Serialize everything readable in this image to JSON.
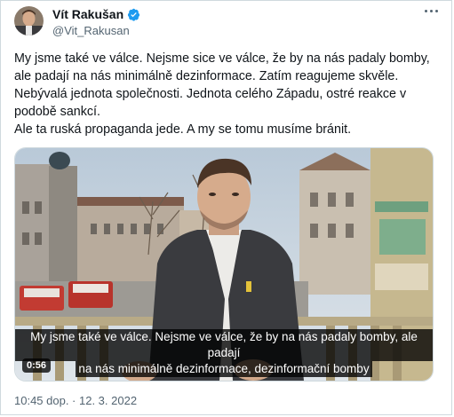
{
  "author": {
    "name": "Vít Rakušan",
    "handle": "@Vit_Rakusan",
    "verified": true,
    "avatar_icon": "avatar-portrait"
  },
  "tweet": {
    "paragraph1": "My jsme také ve válce. Nejsme sice ve válce, že by na nás padaly bomby, ale padají na nás minimálně dezinformace. Zatím reagujeme skvěle. Nebývalá jednota společnosti. Jednota celého Západu, ostré reakce v podobě sankcí.",
    "paragraph2": "Ale ta ruská propaganda jede. A my se tomu musíme bránit."
  },
  "video": {
    "subtitle_line1": "My jsme také ve válce. Nejsme ve válce, že by na nás padaly bomby, ale padají",
    "subtitle_line2": "na nás minimálně dezinformace, dezinformační bomby",
    "duration": "0:56"
  },
  "meta": {
    "timestamp": "10:45 dop. · 12. 3. 2022"
  },
  "colors": {
    "text": "#0f1419",
    "secondary": "#536471",
    "verified": "#1d9bf0",
    "border": "#cfd9de"
  }
}
